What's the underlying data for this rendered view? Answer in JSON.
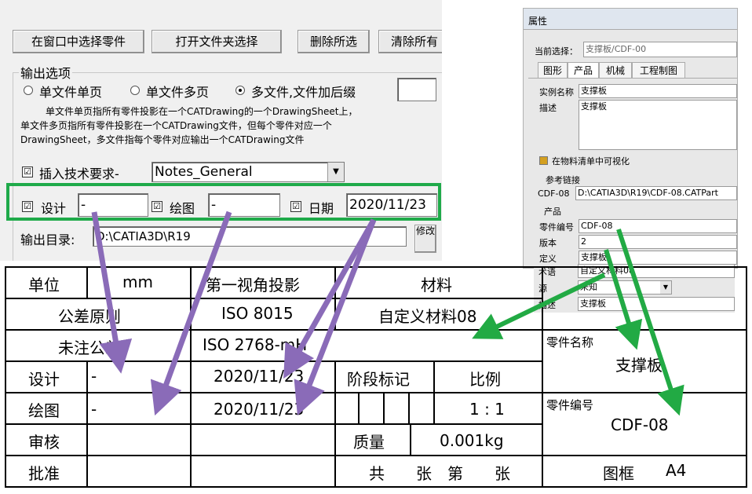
{
  "dialog": {
    "buttons": [
      "在窗口中选择零件",
      "打开文件夹选择",
      "删除所选",
      "清除所有"
    ],
    "output_group": "输出选项",
    "radios": [
      "单文件单页",
      "单文件多页",
      "多文件,文件加后缀"
    ],
    "radio_selected": 2,
    "suffix_value": "",
    "description": [
      "单文件单页指所有零件投影在一个CATDrawing的一个DrawingSheet上，",
      "单文件多页指所有零件投影在一个CATDrawing文件，但每个零件对应一个",
      "DrawingSheet，多文件指每个零件对应输出一个CATDrawing文件"
    ],
    "tech_req_label": "插入技术要求-",
    "tech_req_value": "Notes_General",
    "design_label": "设计",
    "design_value": "-",
    "drawing_label": "绘图",
    "drawing_value": "-",
    "date_label": "日期",
    "date_value": "2020/11/23",
    "output_dir_label": "输出目录:",
    "output_dir_value": "D:\\CATIA3D\\R19",
    "modify_label": "修改",
    "check_mark": "☑",
    "highlight_color": "#1faa4a"
  },
  "props": {
    "title": "属性",
    "current_label": "当前选择：",
    "current_value": "支撑板/CDF-00",
    "tabs": [
      "图形",
      "产品",
      "机械",
      "工程制图"
    ],
    "instance_label": "实例名称",
    "instance_value": "支撑板",
    "desc_label": "描述",
    "desc_value": "支撑板",
    "bom_label": "在物料清单中可视化",
    "ref_group": "参考链接",
    "cdf_label": "CDF-08",
    "cdf_path": "D:\\CATIA3D\\R19\\CDF-08.CATPart",
    "product_group": "产品",
    "part_number_label": "零件编号",
    "part_number_value": "CDF-08",
    "version_label": "版本",
    "version_value": "2",
    "define_label": "定义",
    "define_value": "支撑板",
    "term_label": "术语",
    "term_value": "自定义材料08",
    "source_label": "源",
    "source_value": "未知",
    "desc2_label": "描述",
    "desc2_value": "支撑板"
  },
  "title_block": {
    "unit_label": "单位",
    "unit_value": "mm",
    "projection": "第一视角投影",
    "material_label": "材料",
    "tolerance_label": "公差原则",
    "tolerance_value": "ISO 8015",
    "material_value": "自定义材料08",
    "untol_label": "未注公差",
    "untol_value": "ISO 2768-mH",
    "part_name_label": "零件名称",
    "part_name_value": "支撑板",
    "design_label": "设计",
    "design_value": "-",
    "design_date": "2020/11/23",
    "stage_label": "阶段标记",
    "scale_label": "比例",
    "drawing_label": "绘图",
    "drawing_value": "-",
    "drawing_date": "2020/11/23",
    "scale_value": "1 : 1",
    "part_no_label": "零件编号",
    "part_no_value": "CDF-08",
    "review_label": "审核",
    "mass_label": "质量",
    "mass_value": "0.001kg",
    "approve_label": "批准",
    "sheet_text": "共　　张　第　　张",
    "frame_label": "图框",
    "frame_value": "A4"
  },
  "arrows": {
    "purple": "#8a6bb8",
    "green": "#22aa44"
  }
}
